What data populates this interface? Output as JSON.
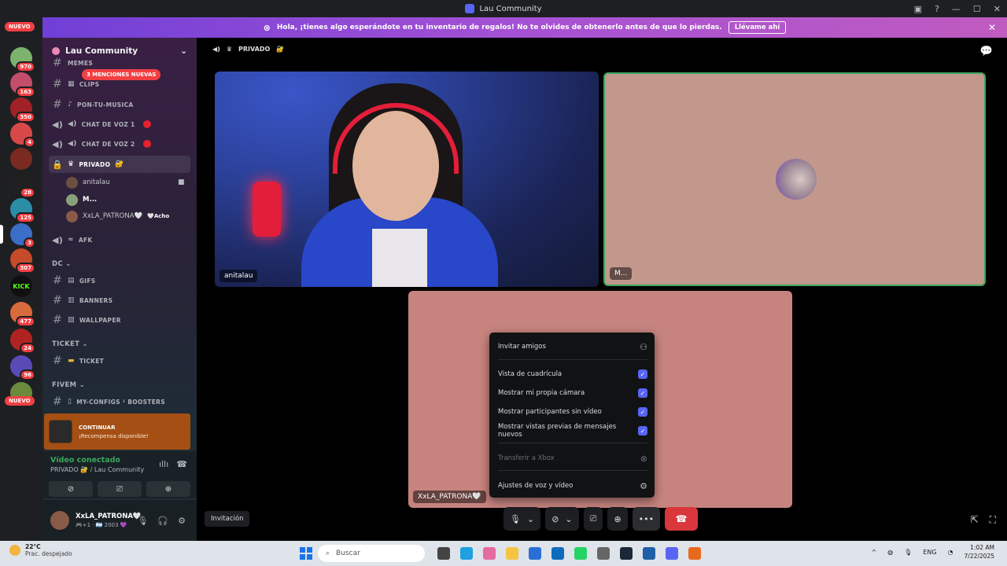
{
  "window": {
    "title": "Lau Community"
  },
  "servers": {
    "nuevo_label": "NUEVO",
    "badges": [
      "970",
      "163",
      "350",
      "4",
      "28",
      "125",
      "3",
      "307",
      "477",
      "24",
      "96"
    ],
    "kick_label": "KICK"
  },
  "banner": {
    "text": "Hola, ¡tienes algo esperándote en tu inventario de regalos! No te olvides de obtenerlo antes de que lo pierdas.",
    "cta": "Llévame ahí"
  },
  "guild": {
    "name": "Lau Community"
  },
  "mentions": "3 MENCIONES NUEVAS",
  "channels": [
    {
      "name": "MEMES",
      "type": "text"
    },
    {
      "name": "CLIPS",
      "type": "text"
    },
    {
      "name": "PON-TU-MUSICA",
      "type": "text"
    },
    {
      "name": "CHAT DE VOZ 1",
      "type": "voice"
    },
    {
      "name": "CHAT DE VOZ 2",
      "type": "voice"
    },
    {
      "name": "PRIVADO",
      "type": "voice"
    }
  ],
  "voice_users": [
    {
      "name": "anitalau"
    },
    {
      "name": "M..."
    },
    {
      "name": "XxLA_PATRONA🤍",
      "tag": "🤍Acho"
    }
  ],
  "afk": "AFK",
  "categories": {
    "dc": "DC",
    "dc_channels": [
      "GIFS",
      "BANNERS",
      "WALLPAPER"
    ],
    "ticket": "TICKET",
    "ticket_channels": [
      "TICKET"
    ],
    "fivem": "FIVEM",
    "fivem_channels": [
      "MY-CONFIGS ¹ BOOSTERS"
    ]
  },
  "reward": {
    "title": "CONTINUAR",
    "text": "¡Recompensa disponible!"
  },
  "voice_panel": {
    "title": "Vídeo conectado",
    "subtitle": "PRIVADO 🔐 / Lau Community"
  },
  "user": {
    "name": "XxLA_PATRONA🤍",
    "status": "🎮+1 · 🇦🇷 2003 💜"
  },
  "call": {
    "channel": "PRIVADO",
    "tiles": [
      {
        "label": "anitalau"
      },
      {
        "label": "M..."
      },
      {
        "label": "XxLA_PATRONA🤍"
      }
    ]
  },
  "menu": {
    "items": [
      {
        "label": "Invitar amigos",
        "icon": "add-friend-icon"
      },
      {
        "label": "Vista de cuadrícula",
        "checked": true
      },
      {
        "label": "Mostrar mi propia cámara",
        "checked": true
      },
      {
        "label": "Mostrar participantes sin vídeo",
        "checked": true
      },
      {
        "label": "Mostrar vistas previas de mensajes nuevos",
        "checked": true
      },
      {
        "label": "Transferir a Xbox",
        "disabled": true,
        "icon": "xbox-icon"
      },
      {
        "label": "Ajustes de voz y vídeo",
        "icon": "gear-icon"
      }
    ]
  },
  "invite_button": "Invitación",
  "taskbar": {
    "weather_temp": "22°C",
    "weather_desc": "Prac. despejado",
    "search_placeholder": "Buscar",
    "lang": "ENG",
    "time": "1:02 AM",
    "date": "7/22/2025"
  }
}
